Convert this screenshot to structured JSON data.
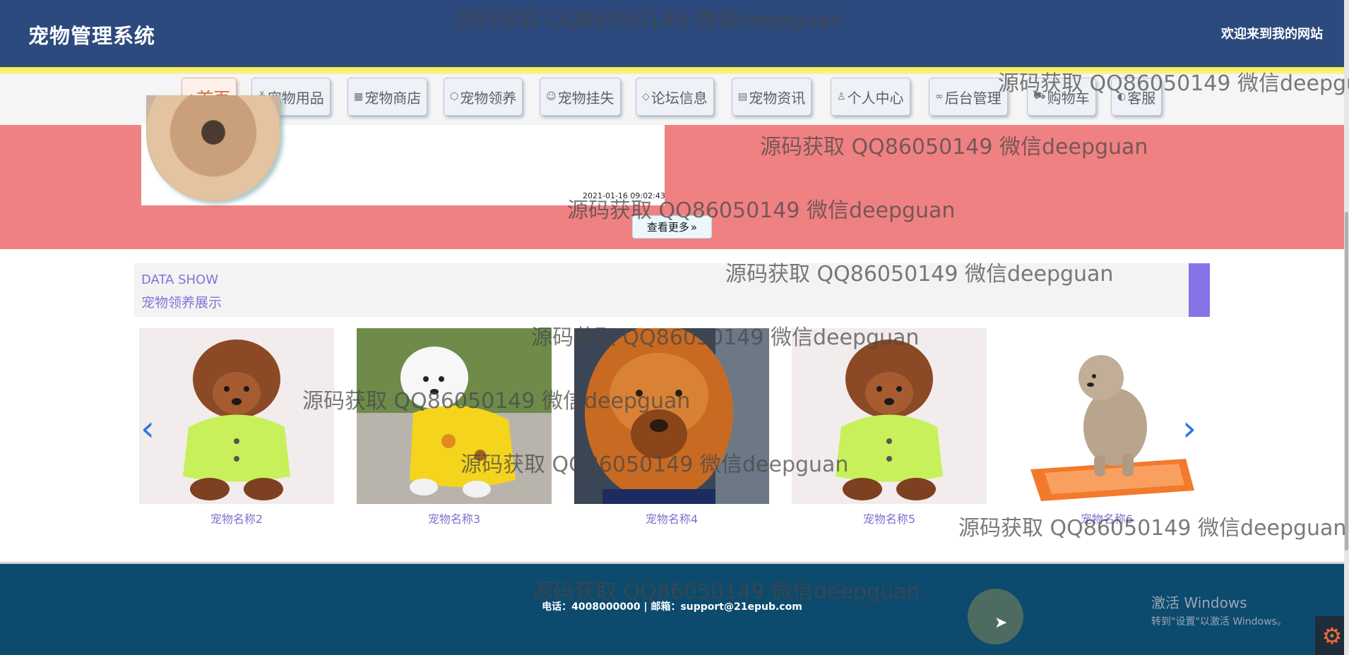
{
  "header": {
    "title": "宠物管理系统",
    "welcome": "欢迎来到我的网站"
  },
  "nav": {
    "items": [
      {
        "label": "首页",
        "icon": "home-icon",
        "glyph": "⌂",
        "active": true
      },
      {
        "label": "宠物用品",
        "icon": "sliders-icon",
        "glyph": "≚"
      },
      {
        "label": "宠物商店",
        "icon": "calendar-icon",
        "glyph": "▦"
      },
      {
        "label": "宠物领养",
        "icon": "cube-icon",
        "glyph": "⬡"
      },
      {
        "label": "宠物挂失",
        "icon": "face-icon",
        "glyph": "☺"
      },
      {
        "label": "论坛信息",
        "icon": "tag-icon",
        "glyph": "◇"
      },
      {
        "label": "宠物资讯",
        "icon": "news-icon",
        "glyph": "▤"
      },
      {
        "label": "个人中心",
        "icon": "user-icon",
        "glyph": "♙"
      },
      {
        "label": "后台管理",
        "icon": "link-icon",
        "glyph": "∞"
      },
      {
        "label": "购物车",
        "icon": "cart-icon",
        "glyph": "⛟"
      },
      {
        "label": "客服",
        "icon": "headset-icon",
        "glyph": "◐"
      }
    ]
  },
  "news": {
    "timestamp": "2021-01-16 09:02:43",
    "more_label": "查看更多",
    "more_icon": "double-chevron-right-icon",
    "more_glyph": "»"
  },
  "section": {
    "title_en": "DATA SHOW",
    "title_cn": "宠物领养展示"
  },
  "carousel": {
    "prev_glyph": "‹",
    "next_glyph": "›",
    "cards": [
      {
        "name": "宠物名称2",
        "image": "brown-poodle-green-coat"
      },
      {
        "name": "宠物名称3",
        "image": "white-poodle-yellow-hoodie"
      },
      {
        "name": "宠物名称4",
        "image": "orange-mastiff"
      },
      {
        "name": "宠物名称5",
        "image": "brown-poodle-green-coat"
      },
      {
        "name": "宠物名称6",
        "image": "poodle-on-orange-bed"
      }
    ]
  },
  "footer": {
    "contact": "电话：4008000000 | 邮箱：support@21epub.com"
  },
  "windows": {
    "line1": "激活 Windows",
    "line2": "转到\"设置\"以激活 Windows。"
  },
  "watermark": {
    "text": "源码获取 QQ86050149 微信deepguan"
  },
  "colors": {
    "header_bg": "#2d4a7e",
    "band": "#f08182",
    "accent": "#8574d6",
    "footer_bg": "#0c4a6e",
    "arrow": "#2b78e0"
  }
}
